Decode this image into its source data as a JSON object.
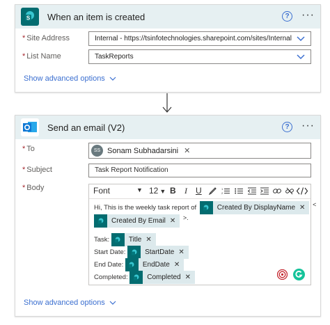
{
  "trigger": {
    "title": "When an item is created",
    "fields": [
      {
        "label": "Site Address",
        "value": "Internal - https://tsinfotechnologies.sharepoint.com/sites/Internal"
      },
      {
        "label": "List Name",
        "value": "TaskReports"
      }
    ],
    "advanced": "Show advanced options"
  },
  "connector_arrow": "↓",
  "action": {
    "title": "Send an email (V2)",
    "to_label": "To",
    "recipient": {
      "initials": "SS",
      "name": "Sonam Subhadarsini"
    },
    "subject_label": "Subject",
    "subject_value": "Task Report Notification",
    "body_label": "Body",
    "toolbar": {
      "font": "Font",
      "size": "12",
      "bold": "B",
      "italic": "I",
      "underline": "U"
    },
    "body": {
      "intro": "Hi, This is the weekly task report of",
      "token_created_by_name": "Created By DisplayName",
      "lt": "<",
      "token_created_by_email": "Created By Email",
      "gt": ">.",
      "task_label": "Task:",
      "token_title": "Title",
      "start_label": "Start Date:",
      "token_start": "StartDate",
      "end_label": "End Date:",
      "token_end": "EndDate",
      "completed_label": "Completed:",
      "token_completed": "Completed"
    },
    "advanced": "Show advanced options"
  },
  "icons": [
    "sharepoint-icon",
    "outlook-icon",
    "help-icon",
    "more-icon",
    "chevron-down-icon",
    "remove-token-icon",
    "grammarly-icon"
  ],
  "colors": {
    "header_bg": "#e6f0f2",
    "sharepoint": "#036c70",
    "outlook": "#0f78d4",
    "link": "#3b6fd0",
    "token_bg": "#dce9ec"
  }
}
